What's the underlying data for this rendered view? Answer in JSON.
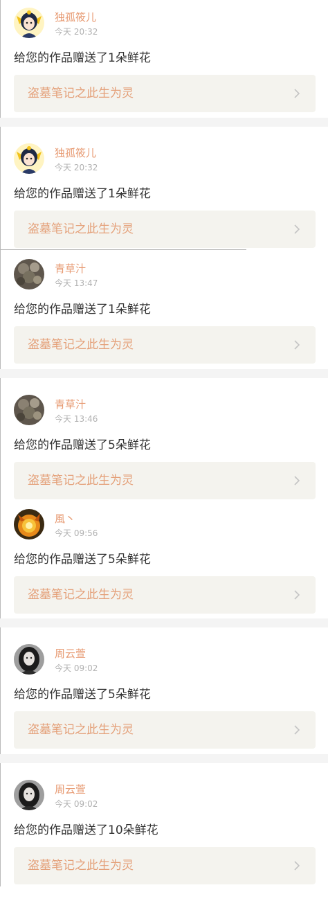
{
  "notifications": [
    {
      "username": "独孤筱儿",
      "time": "今天 20:32",
      "message": "给您的作品赠送了1朵鲜花",
      "work_title": "盗墓笔记之此生为灵",
      "avatar": "cartoon-girl-avatar"
    },
    {
      "username": "独孤筱儿",
      "time": "今天 20:32",
      "message": "给您的作品赠送了1朵鲜花",
      "work_title": "盗墓笔记之此生为灵",
      "avatar": "cartoon-girl-avatar"
    },
    {
      "username": "青草汁",
      "time": "今天 13:47",
      "message": "给您的作品赠送了1朵鲜花",
      "work_title": "盗墓笔记之此生为灵",
      "avatar": "flower-photo-avatar"
    },
    {
      "username": "青草汁",
      "time": "今天 13:46",
      "message": "给您的作品赠送了5朵鲜花",
      "work_title": "盗墓笔记之此生为灵",
      "avatar": "flower-photo-avatar"
    },
    {
      "username": "風丶",
      "time": "今天 09:56",
      "message": "给您的作品赠送了5朵鲜花",
      "work_title": "盗墓笔记之此生为灵",
      "avatar": "fire-anime-avatar"
    },
    {
      "username": "周云萱",
      "time": "今天 09:02",
      "message": "给您的作品赠送了5朵鲜花",
      "work_title": "盗墓笔记之此生为灵",
      "avatar": "dark-girl-photo-avatar"
    },
    {
      "username": "周云萱",
      "time": "今天 09:02",
      "message": "给您的作品赠送了10朵鲜花",
      "work_title": "盗墓笔记之此生为灵",
      "avatar": "dark-girl-photo-avatar"
    }
  ],
  "colors": {
    "username": "#e79a72",
    "work_title": "#e4a079",
    "card_background": "#f4f3ee",
    "separator": "#f4f4f4"
  }
}
